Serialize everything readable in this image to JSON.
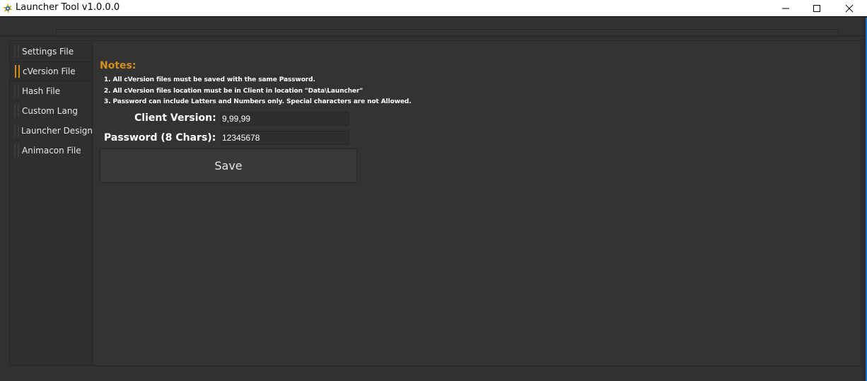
{
  "window": {
    "title": "Launcher Tool v1.0.0.0",
    "icons": {
      "app": "gear-star-app-icon",
      "minimize": "minimize-icon",
      "maximize": "maximize-icon",
      "close": "close-icon"
    }
  },
  "sidebar": {
    "items": [
      {
        "label": "Settings File",
        "active": false
      },
      {
        "label": "cVersion File",
        "active": true
      },
      {
        "label": "Hash File",
        "active": false
      },
      {
        "label": "Custom Lang",
        "active": false
      },
      {
        "label": "Launcher Design",
        "active": false
      },
      {
        "label": "Animacon File",
        "active": false
      }
    ],
    "accent_color": "#d48a12"
  },
  "main": {
    "notes_title": "Notes:",
    "notes": [
      "1. All cVersion files must be saved with the same Password.",
      "2. All cVersion files location must be in Client in location \"Data\\Launcher\"",
      "3. Password can include Latters and Numbers only. Special characters are not Allowed."
    ],
    "client_version": {
      "label": "Client Version:",
      "value": "9,99,99"
    },
    "password": {
      "label": "Password (8 Chars):",
      "value": "12345678"
    },
    "save_label": "Save",
    "notes_color": "#d4901a"
  }
}
